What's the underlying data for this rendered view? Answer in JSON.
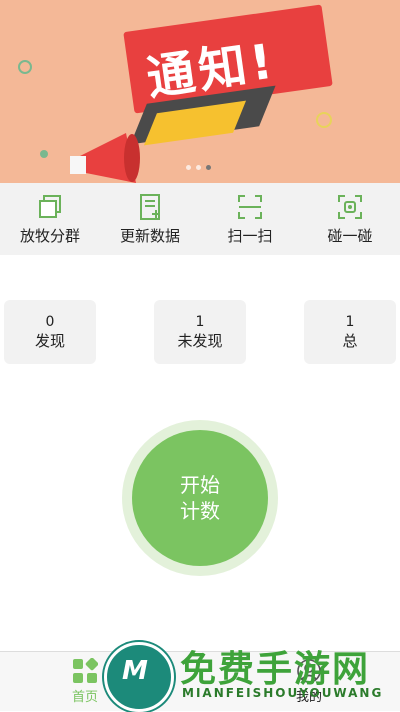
{
  "banner": {
    "title": "通知!",
    "page_count": 3,
    "active_page": 3
  },
  "quick_actions": [
    {
      "label": "放牧分群",
      "icon": "copy-icon"
    },
    {
      "label": "更新数据",
      "icon": "document-add-icon"
    },
    {
      "label": "扫一扫",
      "icon": "scan-icon"
    },
    {
      "label": "碰一碰",
      "icon": "nfc-icon"
    }
  ],
  "stats": [
    {
      "value": "0",
      "label": "发现"
    },
    {
      "value": "1",
      "label": "未发现"
    },
    {
      "value": "1",
      "label": "总"
    }
  ],
  "start_button": {
    "line1": "开始",
    "line2": "计数"
  },
  "tabbar": {
    "home_label": "首页",
    "mine_label": "我的"
  },
  "watermark": {
    "text": "免费手游网",
    "subtext": "MIANFEISHOUYOUWANG"
  },
  "colors": {
    "accent": "#7bc461",
    "banner_bg": "#f4b897",
    "ribbon": "#e8403f"
  }
}
